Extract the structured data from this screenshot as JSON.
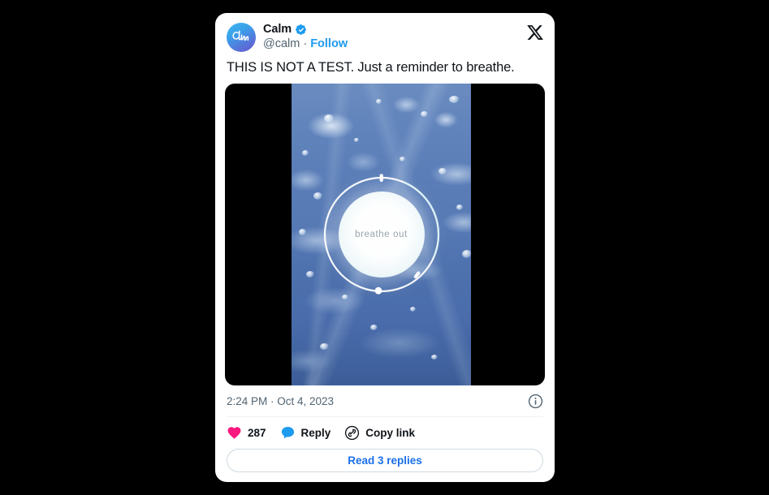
{
  "card": {
    "author": {
      "display_name": "Calm",
      "handle": "@calm",
      "separator": "·",
      "follow_label": "Follow",
      "avatar_text": "Calm",
      "verified": true,
      "verified_color": "#1d9bf0"
    },
    "close_icon": "x-logo",
    "tweet_text": "THIS IS NOT A TEST. Just a reminder to breathe.",
    "media": {
      "type": "video",
      "overlay_label": "breathe out",
      "letterbox_color": "#000000",
      "water_color": "#5b7eb8"
    },
    "meta": {
      "timestamp": "2:24 PM · Oct 4, 2023",
      "info_icon": "info-circle-icon"
    },
    "actions": [
      {
        "icon": "heart-icon",
        "label": "287",
        "color": "#f91880"
      },
      {
        "icon": "reply-icon",
        "label": "Reply",
        "color": "#1d9bf0"
      },
      {
        "icon": "link-icon",
        "label": "Copy link",
        "color": "#0f1419"
      }
    ],
    "read_replies_label": "Read 3 replies",
    "read_replies_color": "#1a6fe8"
  },
  "background_color": "#000000"
}
